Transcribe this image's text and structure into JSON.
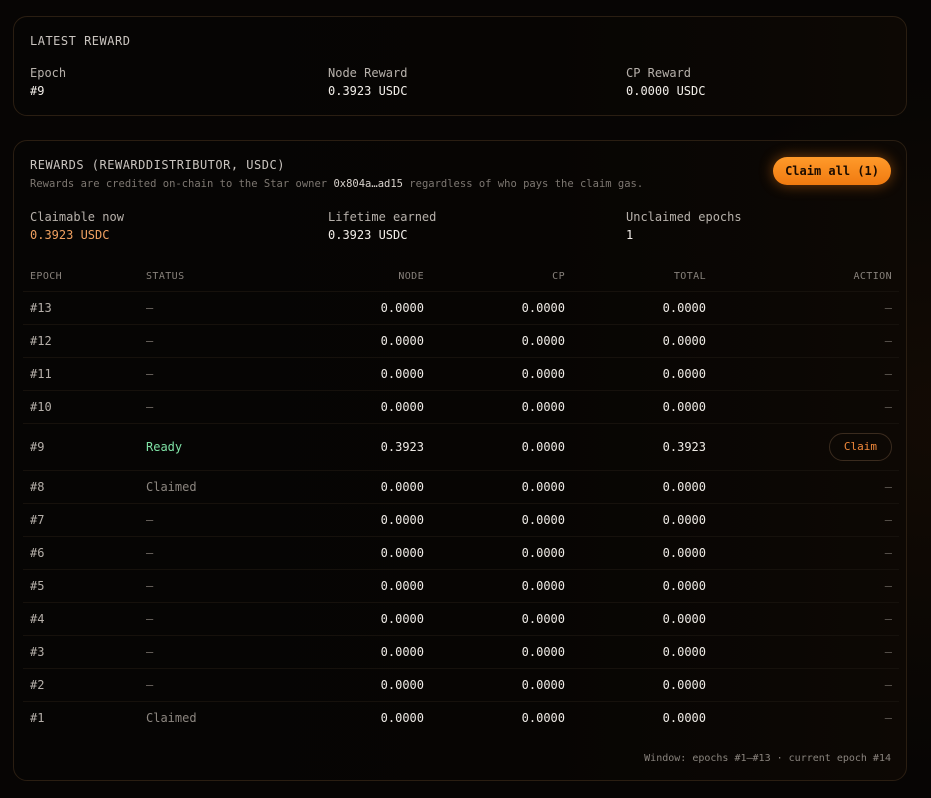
{
  "latest": {
    "title": "LATEST REWARD",
    "stats": [
      {
        "label": "Epoch",
        "value": "#9"
      },
      {
        "label": "Node Reward",
        "value": "0.3923 USDC"
      },
      {
        "label": "CP Reward",
        "value": "0.0000 USDC"
      }
    ]
  },
  "rewards": {
    "title": "REWARDS (REWARDDISTRIBUTOR, USDC)",
    "subtitle_pre": "Rewards are credited on-chain to the Star owner ",
    "subtitle_addr": "0x804a…ad15",
    "subtitle_post": " regardless of who pays the claim gas.",
    "claim_all_label": "Claim all (1)",
    "stats": [
      {
        "label": "Claimable now",
        "value": "0.3923 USDC",
        "color": "#f0a060"
      },
      {
        "label": "Lifetime earned",
        "value": "0.3923 USDC"
      },
      {
        "label": "Unclaimed epochs",
        "value": "1"
      }
    ],
    "columns": [
      "EPOCH",
      "STATUS",
      "NODE",
      "CP",
      "TOTAL",
      "ACTION"
    ],
    "rows": [
      {
        "epoch": "#13",
        "status": "—",
        "node": "0.0000",
        "cp": "0.0000",
        "total": "0.0000",
        "action": "—"
      },
      {
        "epoch": "#12",
        "status": "—",
        "node": "0.0000",
        "cp": "0.0000",
        "total": "0.0000",
        "action": "—"
      },
      {
        "epoch": "#11",
        "status": "—",
        "node": "0.0000",
        "cp": "0.0000",
        "total": "0.0000",
        "action": "—"
      },
      {
        "epoch": "#10",
        "status": "—",
        "node": "0.0000",
        "cp": "0.0000",
        "total": "0.0000",
        "action": "—"
      },
      {
        "epoch": "#9",
        "status": "Ready",
        "node": "0.3923",
        "cp": "0.0000",
        "total": "0.3923",
        "action": "Claim"
      },
      {
        "epoch": "#8",
        "status": "Claimed",
        "node": "0.0000",
        "cp": "0.0000",
        "total": "0.0000",
        "action": "—"
      },
      {
        "epoch": "#7",
        "status": "—",
        "node": "0.0000",
        "cp": "0.0000",
        "total": "0.0000",
        "action": "—"
      },
      {
        "epoch": "#6",
        "status": "—",
        "node": "0.0000",
        "cp": "0.0000",
        "total": "0.0000",
        "action": "—"
      },
      {
        "epoch": "#5",
        "status": "—",
        "node": "0.0000",
        "cp": "0.0000",
        "total": "0.0000",
        "action": "—"
      },
      {
        "epoch": "#4",
        "status": "—",
        "node": "0.0000",
        "cp": "0.0000",
        "total": "0.0000",
        "action": "—"
      },
      {
        "epoch": "#3",
        "status": "—",
        "node": "0.0000",
        "cp": "0.0000",
        "total": "0.0000",
        "action": "—"
      },
      {
        "epoch": "#2",
        "status": "—",
        "node": "0.0000",
        "cp": "0.0000",
        "total": "0.0000",
        "action": "—"
      },
      {
        "epoch": "#1",
        "status": "Claimed",
        "node": "0.0000",
        "cp": "0.0000",
        "total": "0.0000",
        "action": "—"
      }
    ],
    "footer": "Window: epochs #1–#13 · current epoch #14"
  },
  "colors": {
    "accent": "#f07a10",
    "ready": "#7fe2a6",
    "claimable": "#f0a060"
  }
}
